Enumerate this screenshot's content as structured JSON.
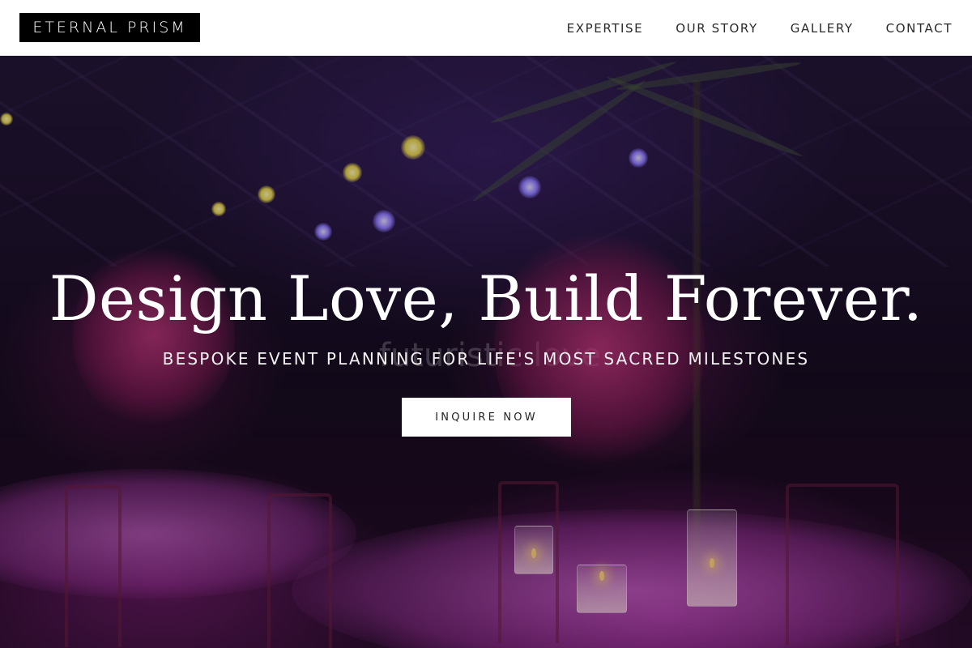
{
  "header": {
    "logo": "ETERNAL PRISM",
    "nav": [
      "EXPERTISE",
      "OUR STORY",
      "GALLERY",
      "CONTACT"
    ]
  },
  "hero": {
    "title": "Design Love, Build Forever.",
    "subtitle": "BESPOKE EVENT PLANNING FOR LIFE'S MOST SACRED MILESTONES",
    "cta_label": "INQUIRE NOW",
    "background_neon_text": "futuristic love"
  },
  "colors": {
    "header_bg": "#ffffff",
    "logo_bg": "#000000",
    "accent_magenta": "#c83ab4",
    "cta_bg": "#ffffff"
  }
}
